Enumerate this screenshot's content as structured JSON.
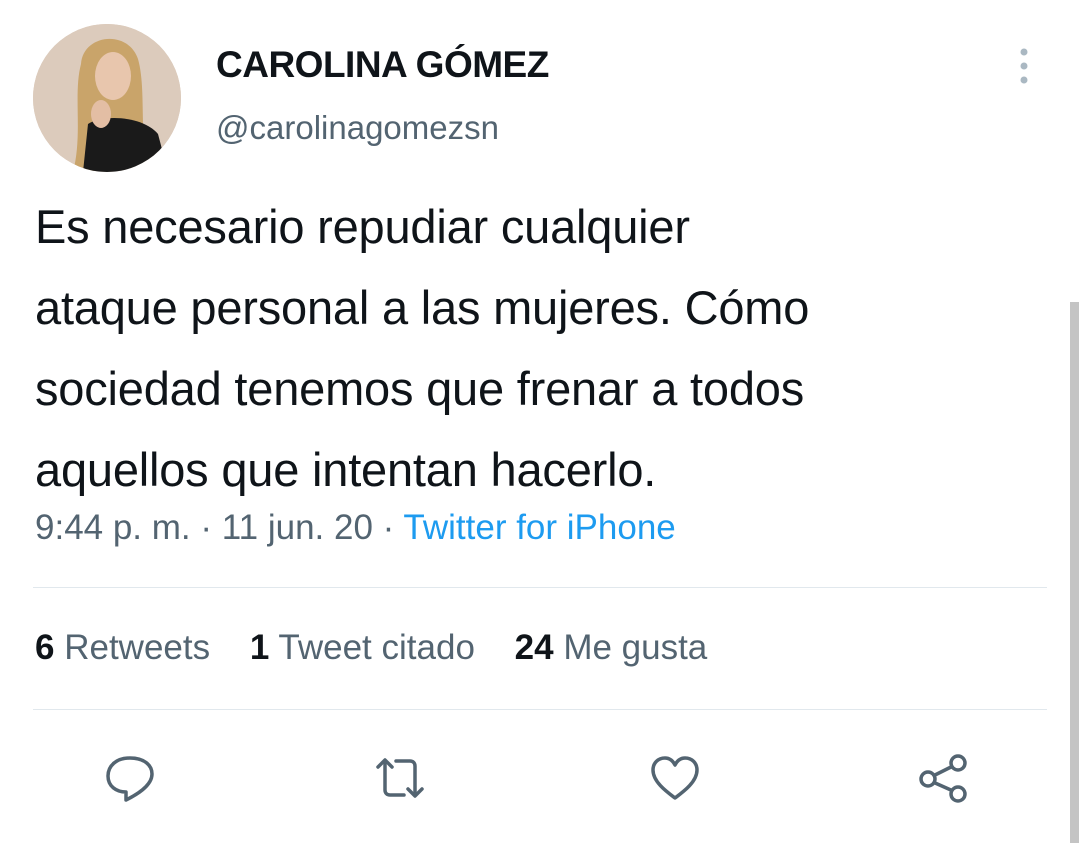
{
  "author": {
    "display_name": "CAROLINA GÓMEZ",
    "handle": "@carolinagomezsn"
  },
  "tweet": {
    "text_lines": [
      "Es necesario repudiar cualquier",
      "ataque personal a las mujeres. Cómo",
      "sociedad tenemos que frenar a todos",
      "aquellos que intentan hacerlo."
    ],
    "time": "9:44 p. m.",
    "date": "11 jun. 20",
    "separator": "·",
    "source": "Twitter for iPhone"
  },
  "stats": {
    "retweets": {
      "count": "6",
      "label": "Retweets"
    },
    "quotes": {
      "count": "1",
      "label": "Tweet citado"
    },
    "likes": {
      "count": "24",
      "label": "Me gusta"
    }
  },
  "actions": [
    "reply-icon",
    "retweet-icon",
    "like-icon",
    "share-icon"
  ],
  "colors": {
    "text_primary": "#0f1419",
    "text_secondary": "#536471",
    "link": "#1d9bf0",
    "icon": "#536471"
  }
}
